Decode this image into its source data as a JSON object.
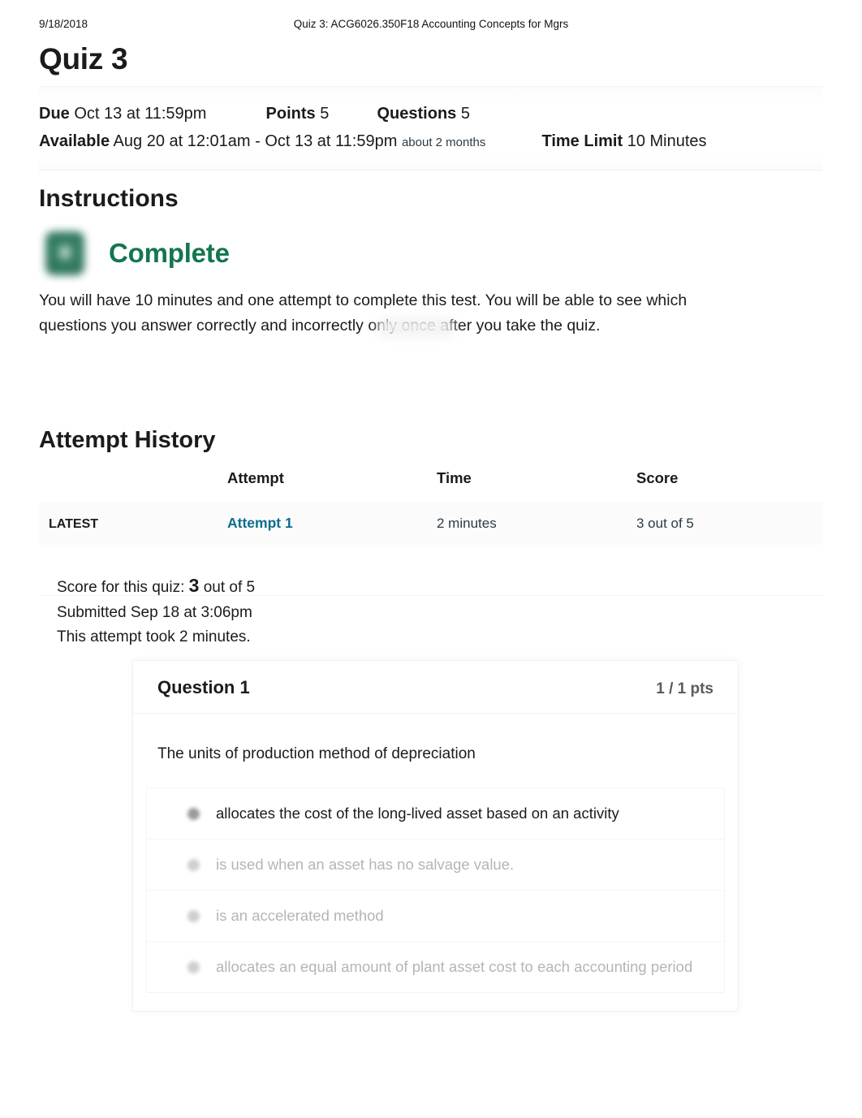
{
  "print_header": {
    "date": "9/18/2018",
    "title": "Quiz 3: ACG6026.350F18 Accounting Concepts for Mgrs"
  },
  "page_title": "Quiz 3",
  "meta": {
    "due_label": "Due",
    "due_value": "Oct 13 at 11:59pm",
    "points_label": "Points",
    "points_value": "5",
    "questions_label": "Questions",
    "questions_value": "5",
    "available_label": "Available",
    "available_value": "Aug 20 at 12:01am - Oct 13 at 11:59pm",
    "available_duration": "about 2 months",
    "time_limit_label": "Time Limit",
    "time_limit_value": "10 Minutes"
  },
  "instructions": {
    "heading": "Instructions",
    "status_badge": "Complete",
    "status_color": "#13764f",
    "body": "You will have 10 minutes and one attempt to complete this test. You will be able to see which questions you answer correctly and incorrectly only once after you take the quiz."
  },
  "attempt_history": {
    "heading": "Attempt History",
    "columns": [
      "",
      "Attempt",
      "Time",
      "Score"
    ],
    "rows": [
      {
        "kept": "LATEST",
        "attempt": "Attempt 1",
        "time": "2 minutes",
        "score": "3 out of 5"
      }
    ],
    "link_color": "#0c6d8e"
  },
  "score_summary": {
    "score_prefix": "Score for this quiz:",
    "score_value": "3",
    "score_suffix": "out of 5",
    "submitted": "Submitted Sep 18 at 3:06pm",
    "duration": "This attempt took 2 minutes."
  },
  "question": {
    "name": "Question 1",
    "points": "1 / 1 pts",
    "text": "The units of production method of depreciation",
    "answers": [
      {
        "text": "allocates the cost of the long-lived asset based on an activity",
        "selected": true
      },
      {
        "text": "is used when an asset has no salvage value.",
        "selected": false
      },
      {
        "text": "is an accelerated method",
        "selected": false
      },
      {
        "text": "allocates an equal amount of plant asset cost to each accounting period",
        "selected": false
      }
    ]
  }
}
